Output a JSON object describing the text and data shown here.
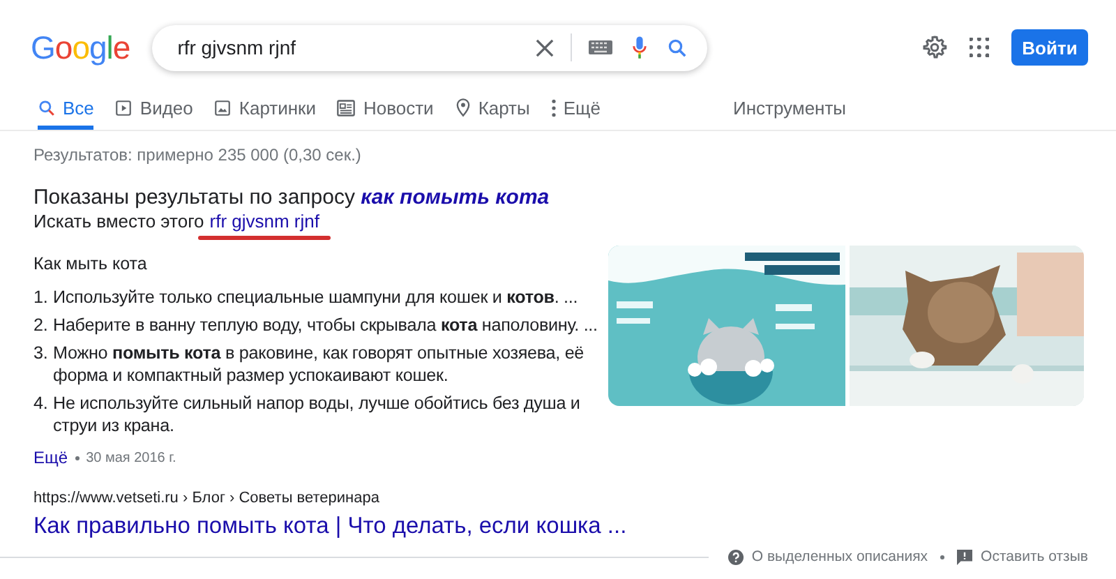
{
  "logo": "Google",
  "search": {
    "value": "rfr gjvsnm rjnf"
  },
  "sign_in_button": "Войти",
  "tabs": [
    {
      "label": "Все",
      "selected": true
    },
    {
      "label": "Видео",
      "selected": false
    },
    {
      "label": "Картинки",
      "selected": false
    },
    {
      "label": "Новости",
      "selected": false
    },
    {
      "label": "Карты",
      "selected": false
    },
    {
      "label": "Ещё",
      "selected": false
    }
  ],
  "tools": "Инструменты",
  "result_stats": "Результатов: примерно 235 000 (0,30 сек.)",
  "spelling": {
    "showing": "Показаны результаты по запросу",
    "corrected": "как помыть кота",
    "instead": "Искать вместо этого",
    "original": "rfr gjvsnm rjnf",
    "underlined": true
  },
  "snippet": {
    "heading": "Как мыть кота",
    "items": [
      {
        "number": "1.",
        "text": "Используйте только специальные шампуни для кошек и **котов**. ..."
      },
      {
        "number": "2.",
        "text": "Наберите в ванну теплую воду, чтобы скрывала **кота** наполовину. ..."
      },
      {
        "number": "3.",
        "text": "Можно **помыть кота** в раковине, как говорят опытные хозяева, её форма и компактный размер успокаивают кошек."
      },
      {
        "number": "4.",
        "text": "Не используйте сильный напор воды, лучше обойтись без душа и струи из крана."
      }
    ],
    "more": "Ещё",
    "date": "30 мая 2016 г.",
    "url": "https://www.vetseti.ru › Блог › Советы ветеринара",
    "title": "Как правильно помыть кота | Что делать, если кошка ..."
  },
  "footer_links": [
    "О выделенных описаниях",
    "Оставить отзыв"
  ]
}
